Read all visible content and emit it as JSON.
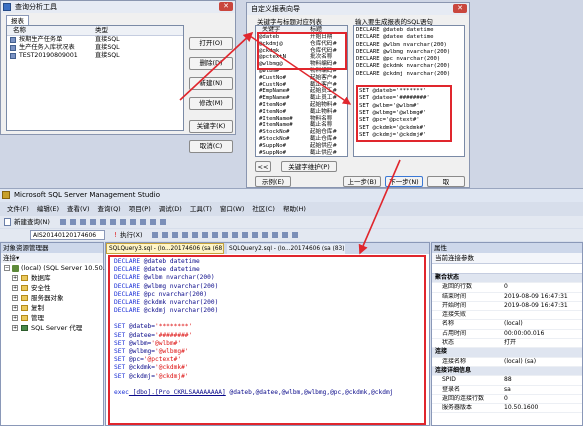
{
  "query_tool": {
    "title": "查询分析工具",
    "tab": "报表",
    "col_name": "名称",
    "col_type": "类型",
    "rows": [
      {
        "name": "按期生产任务单",
        "type": "直接SQL"
      },
      {
        "name": "生产任务入库状况表",
        "type": "直接SQL"
      },
      {
        "name": "TEST20190809001",
        "type": "直接SQL"
      }
    ],
    "buttons": [
      "打开(O)",
      "删除(D)",
      "新建(N)",
      "修改(M)",
      "关键字(K)",
      "取消(C)"
    ]
  },
  "wizard": {
    "title": "自定义报表向导",
    "left_header": "关键字与标题对应列表",
    "col_key": "关键字",
    "col_title": "标题",
    "keys": [
      {
        "k": "@dateb",
        "t": "开始日期"
      },
      {
        "k": "@ckdmj@",
        "t": "仓库代码#"
      },
      {
        "k": "@ckdmk",
        "t": "仓库代码#"
      },
      {
        "k": "@pctextN",
        "t": "批次名称"
      },
      {
        "k": "@wlbmg@",
        "t": "物料编码#"
      },
      {
        "k": "@wlbm#",
        "t": "物料编码#"
      },
      {
        "k": "#CustNo#",
        "t": "起始客户#"
      },
      {
        "k": "#CustNo#",
        "t": "截止客户#"
      },
      {
        "k": "#EmpName#",
        "t": "起始员工#"
      },
      {
        "k": "#EmpName#",
        "t": "截止员工#"
      },
      {
        "k": "#ItemNo#",
        "t": "起始物料#"
      },
      {
        "k": "#ItemNo#",
        "t": "截止物料#"
      },
      {
        "k": "#ItemName#",
        "t": "物料名称"
      },
      {
        "k": "#ItemName#",
        "t": "截止名称"
      },
      {
        "k": "#StockNo#",
        "t": "起始仓库#"
      },
      {
        "k": "#StockNo#",
        "t": "截止仓库#"
      },
      {
        "k": "#SuppNo#",
        "t": "起始供应#"
      },
      {
        "k": "#SuppNo#",
        "t": "截止供应#"
      }
    ],
    "right_header": "输入要生成报表的SQL语句",
    "declares": [
      "DECLARE @dateb datetime",
      "DECLARE @datee datetime",
      "DECLARE @wlbm nvarchar(200)",
      "DECLARE @wlbmg nvarchar(200)",
      "DECLARE @pc nvarchar(200)",
      "DECLARE @ckdmk nvarchar(200)",
      "DECLARE @ckdmj nvarchar(200)"
    ],
    "sets": [
      "SET @dateb='*******'",
      "SET @datee='########'",
      "SET @wlbm='@wlbm#'",
      "SET @wlbmg='@wlbmg#'",
      "SET @pc='@pctext#'",
      "SET @ckdmk='@ckdmk#'",
      "SET @ckdmj='@ckdmj#'"
    ],
    "btn_prev": "<<",
    "btn_maintain": "关键字维护(P)",
    "btn_example": "示例(E)",
    "btn_last": "上一步(B)",
    "btn_next": "下一步(N)",
    "btn_extra": "取"
  },
  "ssms": {
    "title": "Microsoft SQL Server Management Studio",
    "menu": [
      "文件(F)",
      "编辑(E)",
      "查看(V)",
      "查询(Q)",
      "项目(P)",
      "调试(D)",
      "工具(T)",
      "窗口(W)",
      "社区(C)",
      "帮助(H)"
    ],
    "new_query": "新建查询(N)",
    "db_selector": "AIS20140120174606",
    "execute": "执行(X)",
    "object_explorer": {
      "header": "对象资源管理器",
      "connect": "连接▾",
      "server": "(local) (SQL Server 10.50.1",
      "items": [
        "数据库",
        "安全性",
        "服务器对象",
        "复制",
        "管理",
        "SQL Server 代理"
      ]
    },
    "editor_tabs": [
      "SQLQuery3.sql - (lo...20174606 (sa (68))",
      "SQLQuery2.sql - (lo...20174606 (sa (83))"
    ],
    "code_declares": [
      {
        "kw": "DECLARE",
        "rest": " @dateb datetime"
      },
      {
        "kw": "DECLARE",
        "rest": " @datee datetime"
      },
      {
        "kw": "DECLARE",
        "rest": " @wlbm nvarchar(200)"
      },
      {
        "kw": "DECLARE",
        "rest": " @wlbmg nvarchar(200)"
      },
      {
        "kw": "DECLARE",
        "rest": " @pc nvarchar(200)"
      },
      {
        "kw": "DECLARE",
        "rest": " @ckdmk nvarchar(200)"
      },
      {
        "kw": "DECLARE",
        "rest": " @ckdmj nvarchar(200)"
      }
    ],
    "code_sets": [
      {
        "kw": "SET",
        "var": " @dateb=",
        "val": "'********'"
      },
      {
        "kw": "SET",
        "var": " @datee=",
        "val": "'########'"
      },
      {
        "kw": "SET",
        "var": " @wlbm=",
        "val": "'@wlbm#'"
      },
      {
        "kw": "SET",
        "var": " @wlbmg=",
        "val": "'@wlbmg#'"
      },
      {
        "kw": "SET",
        "var": " @pc=",
        "val": "'@pctext#'"
      },
      {
        "kw": "SET",
        "var": " @ckdmk=",
        "val": "'@ckdmk#'"
      },
      {
        "kw": "SET",
        "var": " @ckdmj=",
        "val": "'@ckdmj#'"
      }
    ],
    "code_exec": {
      "kw": "exec",
      "proc": " [dbo].[Pro_CKRLSAAAAAAAA]",
      "args": " @dateb,@datee,@wlbm,@wlbmg,@pc,@ckdmk,@ckdmj"
    },
    "properties": {
      "header": "属性",
      "subheader": "当前连接参数",
      "sections": [
        {
          "title": "聚合状态",
          "rows": [
            {
              "k": "返回的行数",
              "v": "0"
            },
            {
              "k": "结束时间",
              "v": "2019-08-09 16:47:31"
            },
            {
              "k": "开始时间",
              "v": "2019-08-09 16:47:31"
            },
            {
              "k": "连接失败",
              "v": ""
            },
            {
              "k": "名称",
              "v": "(local)"
            },
            {
              "k": "占用时间",
              "v": "00:00:00.016"
            },
            {
              "k": "状态",
              "v": "打开"
            }
          ]
        },
        {
          "title": "连接",
          "rows": [
            {
              "k": "连接名称",
              "v": "(local) (sa)"
            }
          ]
        },
        {
          "title": "连接详细信息",
          "rows": [
            {
              "k": "SPID",
              "v": "88"
            },
            {
              "k": "登录名",
              "v": "sa"
            },
            {
              "k": "返回的连接行数",
              "v": "0"
            },
            {
              "k": "服务器版本",
              "v": "10.50.1600"
            }
          ]
        }
      ]
    }
  }
}
